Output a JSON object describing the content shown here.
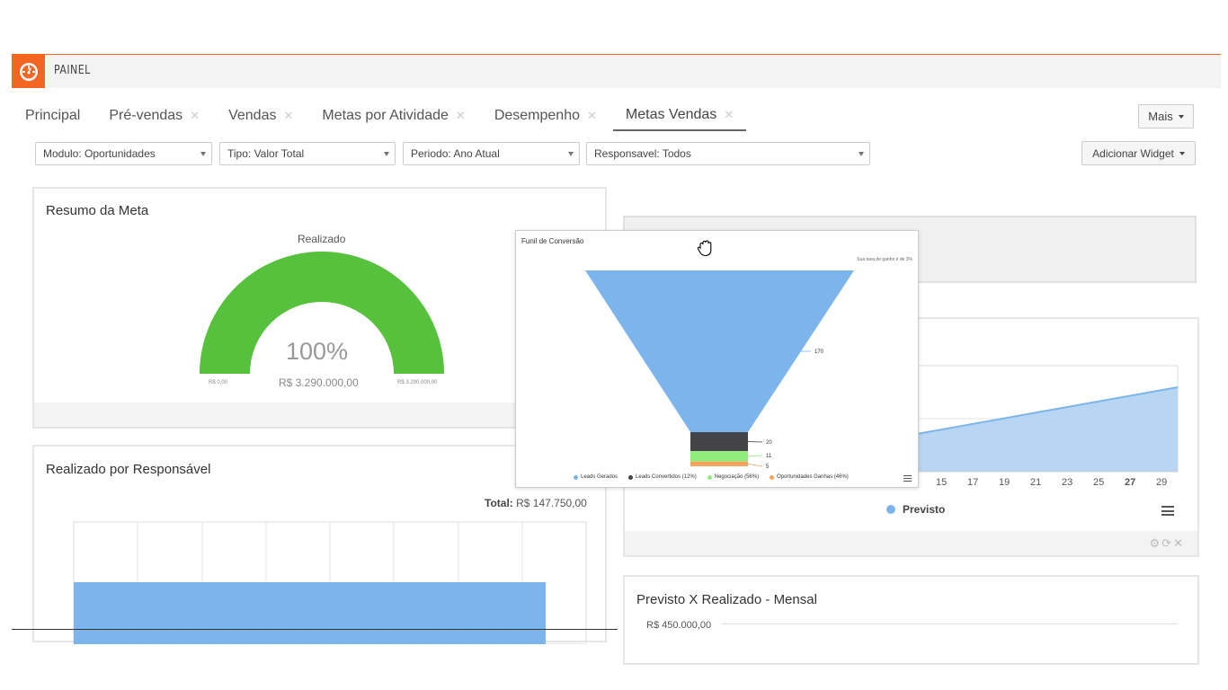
{
  "header": {
    "title": "PAINEL",
    "logo_icon": "dashboard-gauge-icon"
  },
  "tabs": [
    {
      "label": "Principal",
      "closable": false
    },
    {
      "label": "Pré-vendas",
      "closable": true
    },
    {
      "label": "Vendas",
      "closable": true
    },
    {
      "label": "Metas por Atividade",
      "closable": true
    },
    {
      "label": "Desempenho",
      "closable": true
    },
    {
      "label": "Metas Vendas",
      "closable": true,
      "active": true
    }
  ],
  "mais_button": "Mais",
  "filters": {
    "modulo": "Modulo: Oportunidades",
    "tipo": "Tipo: Valor Total",
    "periodo": "Periodo: Ano Atual",
    "responsavel": "Responsavel: Todos"
  },
  "add_widget_button": "Adicionar Widget",
  "resumo": {
    "title": "Resumo da Meta",
    "gauge_label": "Realizado",
    "percent": "100%",
    "percent_value": 100,
    "value": "R$ 3.290.000,00",
    "min": "R$ 0,00",
    "max": "R$ 3.290.000,00",
    "color": "#56c13c"
  },
  "responsavel": {
    "title": "Realizado por Responsável",
    "total_label": "Total:",
    "total_value": "R$ 147.750,00",
    "bar_color": "#7cb5ec"
  },
  "previsto": {
    "x_ticks": [
      "15",
      "17",
      "19",
      "21",
      "23",
      "25",
      "27",
      "29"
    ],
    "legend": "Previsto",
    "footer_icons": "⚙⟳✕"
  },
  "mensal": {
    "title": "Previsto X Realizado - Mensal",
    "y_tick": "R$ 450.000,00"
  },
  "funnel": {
    "title": "Funil de Conversão",
    "subtitle": "Sua taxa de ganho é de 3%",
    "chart_data": {
      "type": "funnel",
      "stages": [
        {
          "name": "Leads Gerados",
          "value": 170,
          "color": "#7cb5ec"
        },
        {
          "name": "Leads Convertidos (12%)",
          "value": 20,
          "color": "#434348"
        },
        {
          "name": "Negociação (56%)",
          "value": 11,
          "color": "#90ed7d"
        },
        {
          "name": "Oportunidades Ganhas (46%)",
          "value": 5,
          "color": "#f7a35c"
        }
      ]
    }
  }
}
